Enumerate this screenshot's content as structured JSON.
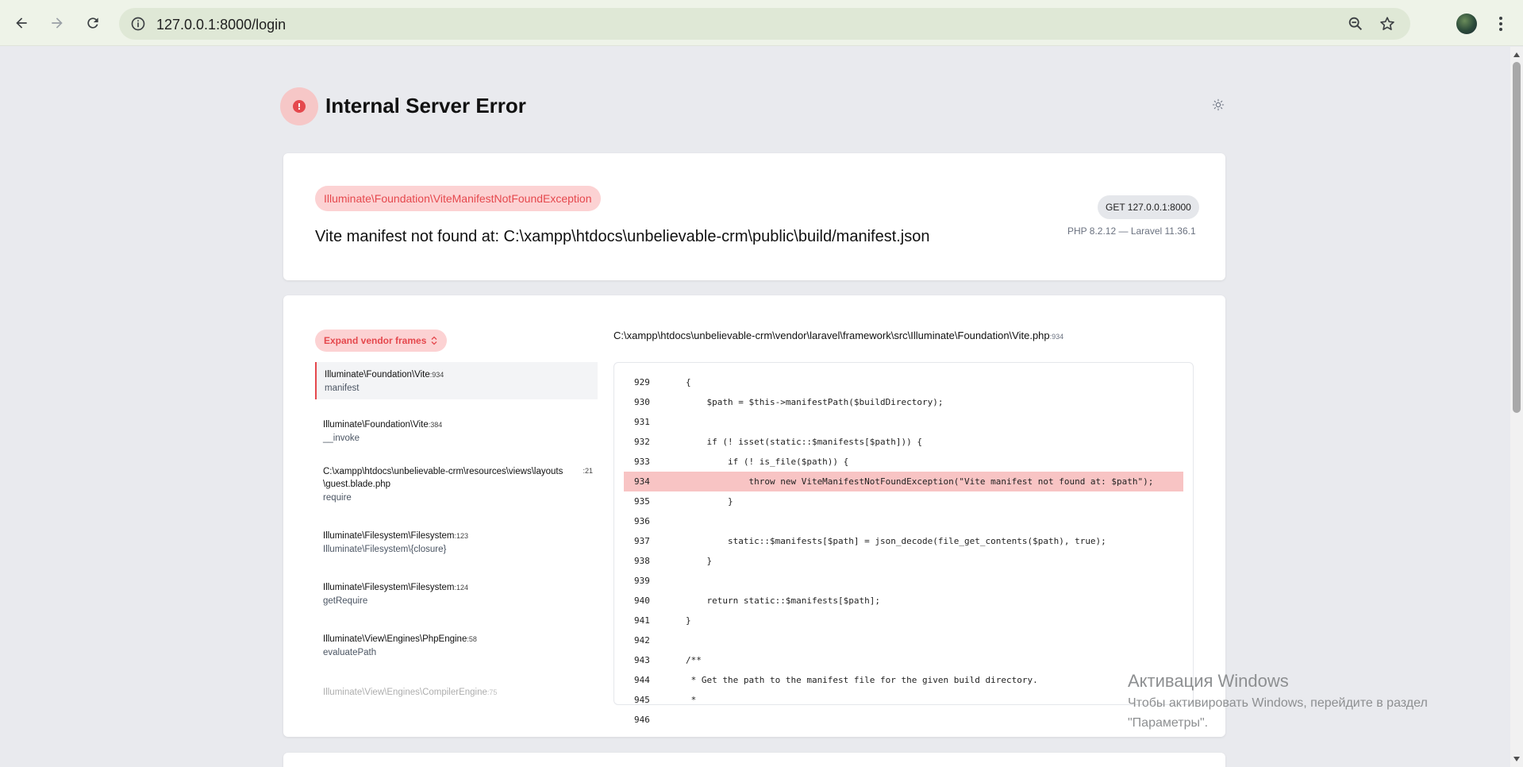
{
  "browser": {
    "url": "127.0.0.1:8000/login"
  },
  "page": {
    "title": "Internal Server Error"
  },
  "exception": {
    "class": "Illuminate\\Foundation\\ViteManifestNotFoundException",
    "message": "Vite manifest not found at: C:\\xampp\\htdocs\\unbelievable-crm\\public\\build/manifest.json",
    "request": "GET 127.0.0.1:8000",
    "versions": "PHP 8.2.12 — Laravel 11.36.1"
  },
  "trace": {
    "expand_label": "Expand vendor frames",
    "frames": [
      {
        "cls": "Illuminate\\Foundation\\Vite",
        "line": ":934",
        "fn": "manifest"
      },
      {
        "cls": "Illuminate\\Foundation\\Vite",
        "line": ":384",
        "fn": "__invoke"
      },
      {
        "cls": "C:\\xampp\\htdocs\\unbelievable-crm\\resources\\views\\layouts\\guest.blade.php",
        "line": ":21",
        "fn": "require"
      },
      {
        "cls": "Illuminate\\Filesystem\\Filesystem",
        "line": ":123",
        "fn": "Illuminate\\Filesystem\\{closure}"
      },
      {
        "cls": "Illuminate\\Filesystem\\Filesystem",
        "line": ":124",
        "fn": "getRequire"
      },
      {
        "cls": "Illuminate\\View\\Engines\\PhpEngine",
        "line": ":58",
        "fn": "evaluatePath"
      },
      {
        "cls": "Illuminate\\View\\Engines\\CompilerEngine",
        "line": ":75",
        "fn": ""
      }
    ]
  },
  "code": {
    "path": "C:\\xampp\\htdocs\\unbelievable-crm\\vendor\\laravel\\framework\\src\\Illuminate\\Foundation\\Vite.php",
    "path_line": ":934",
    "highlight_line": "934",
    "lines": [
      {
        "num": "929",
        "text": "{"
      },
      {
        "num": "930",
        "text": "    $path = $this->manifestPath($buildDirectory);"
      },
      {
        "num": "931",
        "text": ""
      },
      {
        "num": "932",
        "text": "    if (! isset(static::$manifests[$path])) {"
      },
      {
        "num": "933",
        "text": "        if (! is_file($path)) {"
      },
      {
        "num": "934",
        "text": "            throw new ViteManifestNotFoundException(\"Vite manifest not found at: $path\");"
      },
      {
        "num": "935",
        "text": "        }"
      },
      {
        "num": "936",
        "text": ""
      },
      {
        "num": "937",
        "text": "        static::$manifests[$path] = json_decode(file_get_contents($path), true);"
      },
      {
        "num": "938",
        "text": "    }"
      },
      {
        "num": "939",
        "text": ""
      },
      {
        "num": "940",
        "text": "    return static::$manifests[$path];"
      },
      {
        "num": "941",
        "text": "}"
      },
      {
        "num": "942",
        "text": ""
      },
      {
        "num": "943",
        "text": "/**"
      },
      {
        "num": "944",
        "text": " * Get the path to the manifest file for the given build directory."
      },
      {
        "num": "945",
        "text": " *"
      },
      {
        "num": "946",
        "text": ""
      }
    ]
  },
  "watermark": {
    "title": "Активация Windows",
    "line1": "Чтобы активировать Windows, перейдите в раздел",
    "line2": "\"Параметры\"."
  },
  "colors": {
    "accent": "#e5484d",
    "accent_bg": "#fcd2d3",
    "highlight_bg": "#f8c4c4",
    "page_bg": "#e9eaee"
  }
}
